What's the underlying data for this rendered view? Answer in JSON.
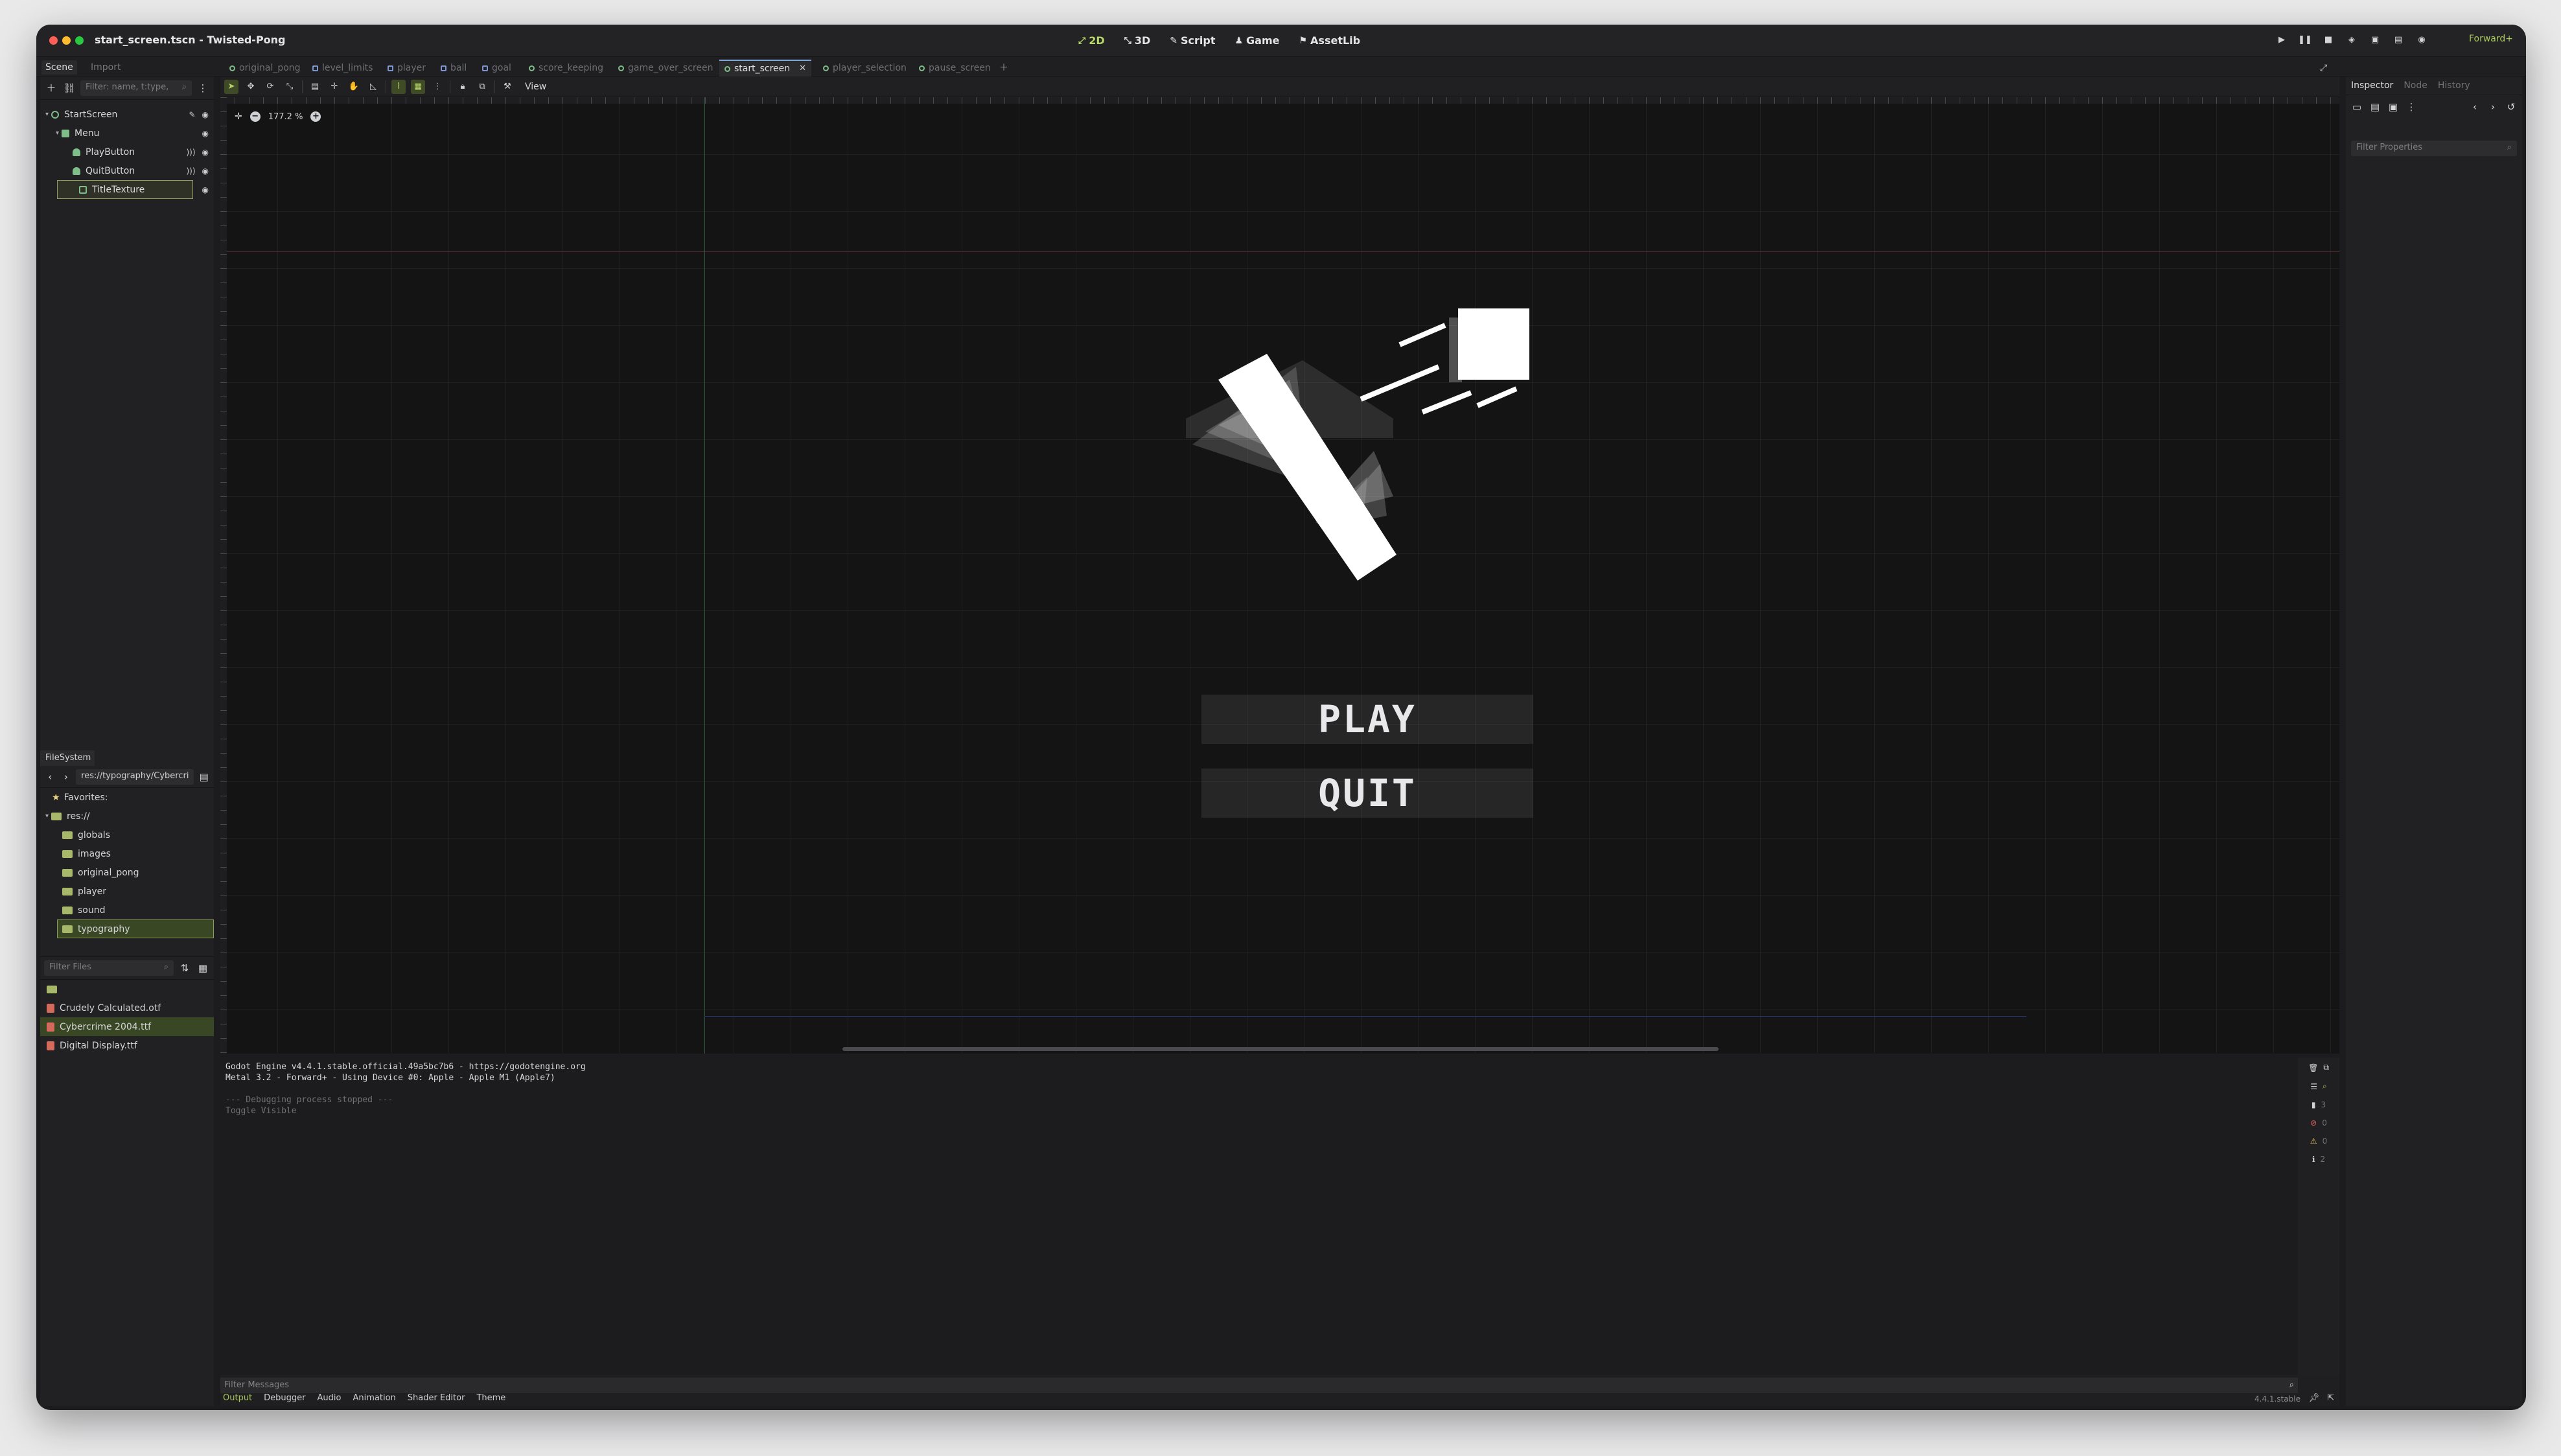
{
  "window": {
    "title": "start_screen.tscn - Twisted-Pong"
  },
  "modes": [
    {
      "icon": "2d-icon",
      "label": "2D"
    },
    {
      "icon": "3d-icon",
      "label": "3D"
    },
    {
      "icon": "script-icon",
      "label": "Script"
    },
    {
      "icon": "game-icon",
      "label": "Game"
    },
    {
      "icon": "assetlib-icon",
      "label": "AssetLib"
    }
  ],
  "renderer": "Forward+",
  "left_dock_tabs": [
    "Scene",
    "Import"
  ],
  "editor_tabs": [
    "original_pong",
    "level_limits",
    "player",
    "ball",
    "goal",
    "score_keeping",
    "game_over_screen",
    "start_screen",
    "player_selection",
    "pause_screen"
  ],
  "active_tab": "start_screen",
  "scene": {
    "filter_placeholder": "Filter: name, t:type,",
    "nodes": [
      {
        "name": "StartScreen",
        "depth": 0
      },
      {
        "name": "Menu",
        "depth": 1
      },
      {
        "name": "PlayButton",
        "depth": 2
      },
      {
        "name": "QuitButton",
        "depth": 2
      },
      {
        "name": "TitleTexture",
        "depth": 1
      }
    ]
  },
  "filesystem": {
    "title": "FileSystem",
    "path": "res://typography/Cybercri",
    "favorites": "Favorites:",
    "root": "res://",
    "folders": [
      "globals",
      "images",
      "original_pong",
      "player",
      "sound",
      "typography"
    ],
    "filter_placeholder": "Filter Files",
    "files": [
      "Crudely Calculated.otf",
      "Cybercrime 2004.ttf",
      "Digital Display.ttf"
    ]
  },
  "viewport": {
    "zoom": "177.2 %",
    "view_label": "View",
    "play_label": "PLAY",
    "quit_label": "QUIT"
  },
  "inspector": {
    "tabs": [
      "Inspector",
      "Node",
      "History"
    ],
    "filter_placeholder": "Filter Properties"
  },
  "output": {
    "lines": [
      "Godot Engine v4.4.1.stable.official.49a5bc7b6 - https://godotengine.org",
      "Metal 3.2 - Forward+ - Using Device #0: Apple - Apple M1 (Apple7)",
      "",
      "--- Debugging process stopped ---",
      "Toggle Visible"
    ],
    "filter_placeholder": "Filter Messages",
    "counts": [
      "3",
      "0",
      "0",
      "2"
    ]
  },
  "bottom_tabs": [
    "Output",
    "Debugger",
    "Audio",
    "Animation",
    "Shader Editor",
    "Theme"
  ],
  "version": "4.4.1.stable",
  "colors": {
    "accent": "#a6c45c",
    "tab_accent": "#7ea5d7"
  }
}
